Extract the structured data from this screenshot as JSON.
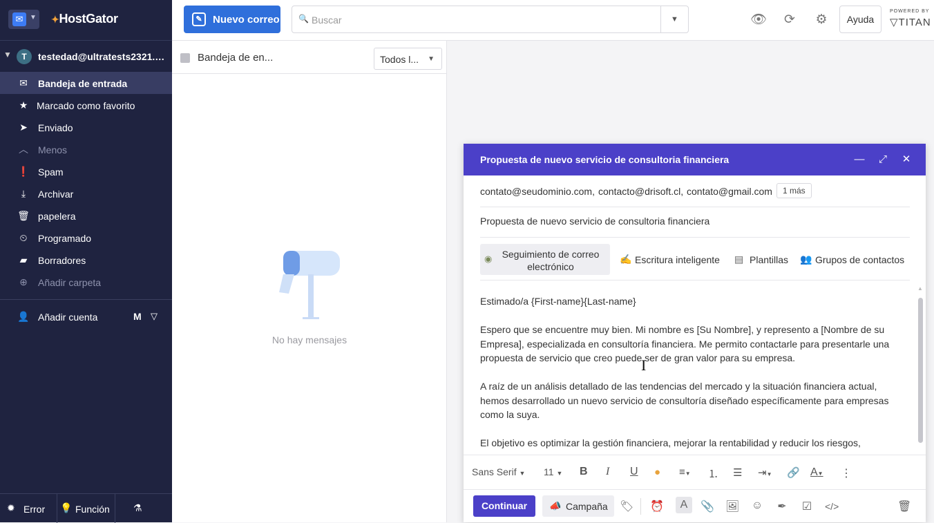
{
  "brand": {
    "name": "HostGator"
  },
  "sidebar": {
    "account": {
      "initial": "T",
      "email": "testedad@ultratests2321.c..."
    },
    "items": [
      {
        "label": "Bandeja de entrada",
        "icon": "inbox-icon"
      },
      {
        "label": "Marcado como favorito",
        "icon": "star-icon"
      },
      {
        "label": "Enviado",
        "icon": "send-icon"
      },
      {
        "label": "Menos",
        "icon": "chevron-up-icon"
      },
      {
        "label": "Spam",
        "icon": "alert-icon"
      },
      {
        "label": "Archivar",
        "icon": "archive-icon"
      },
      {
        "label": "papelera",
        "icon": "trash-icon"
      },
      {
        "label": "Programado",
        "icon": "schedule-icon"
      },
      {
        "label": "Borradores",
        "icon": "drafts-icon"
      },
      {
        "label": "Añadir carpeta",
        "icon": "add-folder-icon"
      }
    ],
    "add_account": "Añadir cuenta",
    "bottom": {
      "error": "Error",
      "feature": "Función"
    }
  },
  "topbar": {
    "new_mail": "Nuevo correo",
    "search_placeholder": "Buscar",
    "help": "Ayuda",
    "powered_by": "POWERED BY",
    "titan": "TITAN"
  },
  "list": {
    "title": "Bandeja de en...",
    "filter": "Todos l...",
    "empty": "No hay mensajes"
  },
  "compose": {
    "title": "Propuesta de nuevo servicio de consultoria financiera",
    "recipients": [
      "contato@seudominio.com,",
      "contacto@drisoft.cl,",
      "contato@gmail.com"
    ],
    "more": "1 más",
    "subject": "Propuesta de nuevo servicio de consultoria financiera",
    "tools": {
      "tracking": "Seguimiento de correo electrónico",
      "smart_write": "Escritura inteligente",
      "templates": "Plantillas",
      "contact_groups": "Grupos de contactos"
    },
    "body": [
      "Estimado/a {First-name}{Last-name}",
      "Espero que se encuentre muy bien. Mi nombre es [Su Nombre], y represento a [Nombre de su Empresa], especializada en consultoría financiera. Me permito contactarle para presentarle una propuesta de servicio que creo puede ser de gran valor para su empresa.",
      "A raíz de un análisis detallado de las tendencias del mercado y la situación financiera actual, hemos desarrollado un nuevo servicio de consultoría diseñado específicamente para empresas como la suya.",
      "El objetivo es optimizar la gestión financiera, mejorar la rentabilidad y reducir los riesgos,"
    ],
    "format": {
      "font": "Sans Serif",
      "size": "11"
    },
    "send": "Continuar",
    "campaign": "Campaña"
  }
}
